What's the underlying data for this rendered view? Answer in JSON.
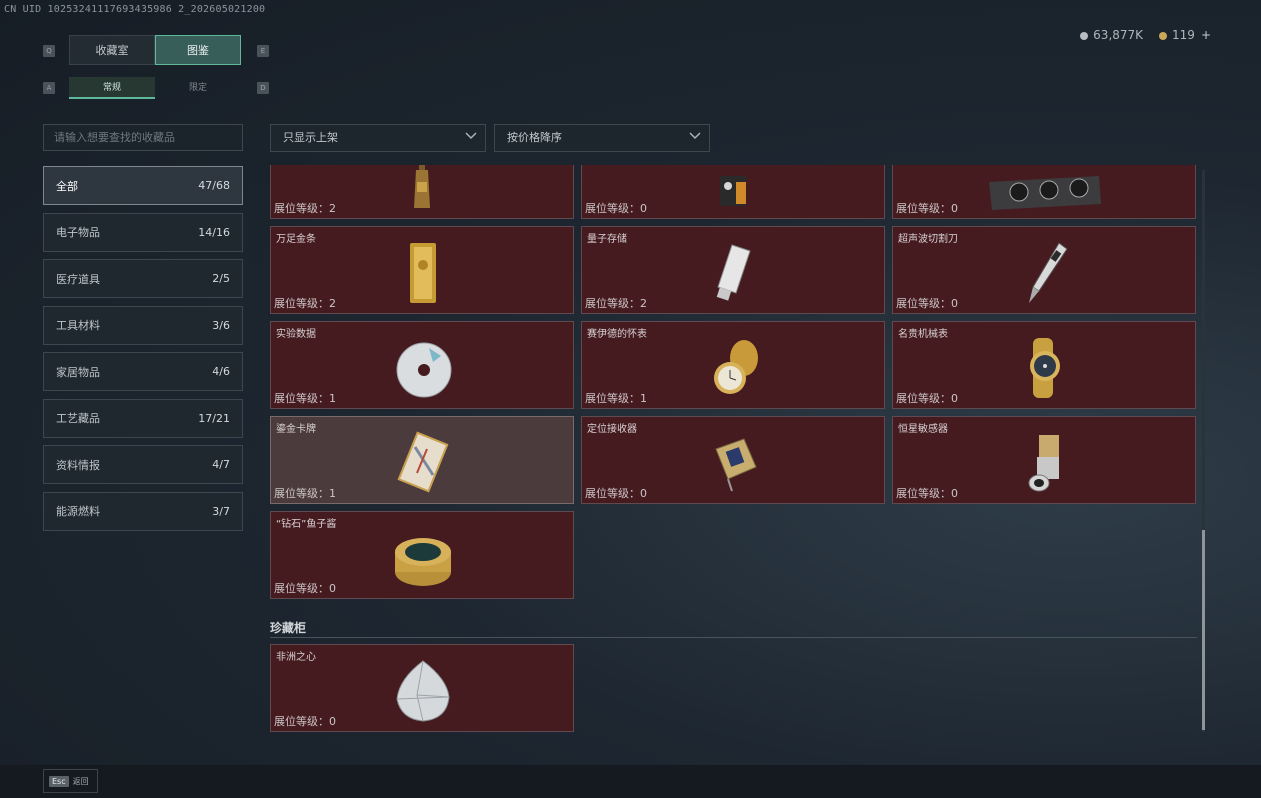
{
  "header": {
    "uid": "CN UID 10253241117693435986 2_202605021200",
    "silver_amount": "63,877K",
    "gold_amount": "119",
    "plus_label": "+"
  },
  "keys": {
    "q": "Q",
    "e": "E",
    "a": "A",
    "d": "D"
  },
  "tabs": {
    "main": [
      {
        "label": "收藏室"
      },
      {
        "label": "图鉴"
      }
    ],
    "sub": [
      {
        "label": "常规"
      },
      {
        "label": "限定"
      }
    ]
  },
  "search": {
    "placeholder": "请输入想要查找的收藏品"
  },
  "categories": [
    {
      "label": "全部",
      "count": "47/68"
    },
    {
      "label": "电子物品",
      "count": "14/16"
    },
    {
      "label": "医疗道具",
      "count": "2/5"
    },
    {
      "label": "工具材料",
      "count": "3/6"
    },
    {
      "label": "家居物品",
      "count": "4/6"
    },
    {
      "label": "工艺藏品",
      "count": "17/21"
    },
    {
      "label": "资料情报",
      "count": "4/7"
    },
    {
      "label": "能源燃料",
      "count": "3/7"
    }
  ],
  "filters": {
    "shelf": "只显示上架",
    "sort": "按价格降序"
  },
  "level_prefix": "展位等级：",
  "items": [
    {
      "name": "",
      "level": "2",
      "icon": "bottle-icon"
    },
    {
      "name": "",
      "level": "0",
      "icon": "device-icon"
    },
    {
      "name": "",
      "level": "0",
      "icon": "graphics-card-icon"
    },
    {
      "name": "万足金条",
      "level": "2",
      "icon": "gold-bar-icon"
    },
    {
      "name": "量子存储",
      "level": "2",
      "icon": "usb-drive-icon"
    },
    {
      "name": "超声波切割刀",
      "level": "0",
      "icon": "cutter-knife-icon"
    },
    {
      "name": "实验数据",
      "level": "1",
      "icon": "disc-icon"
    },
    {
      "name": "赛伊德的怀表",
      "level": "1",
      "icon": "pocket-watch-icon"
    },
    {
      "name": "名贵机械表",
      "level": "0",
      "icon": "wrist-watch-icon"
    },
    {
      "name": "鎏金卡牌",
      "level": "1",
      "icon": "card-icon"
    },
    {
      "name": "定位接收器",
      "level": "0",
      "icon": "receiver-icon"
    },
    {
      "name": "恒星敏感器",
      "level": "0",
      "icon": "sensor-icon"
    },
    {
      "name": "“钻石”鱼子酱",
      "level": "0",
      "icon": "caviar-tin-icon"
    }
  ],
  "vault": {
    "title": "珍藏柜",
    "items": [
      {
        "name": "非洲之心",
        "level": "0",
        "icon": "diamond-icon"
      }
    ]
  },
  "footer": {
    "esc_key": "Esc",
    "esc_label": "返回"
  }
}
